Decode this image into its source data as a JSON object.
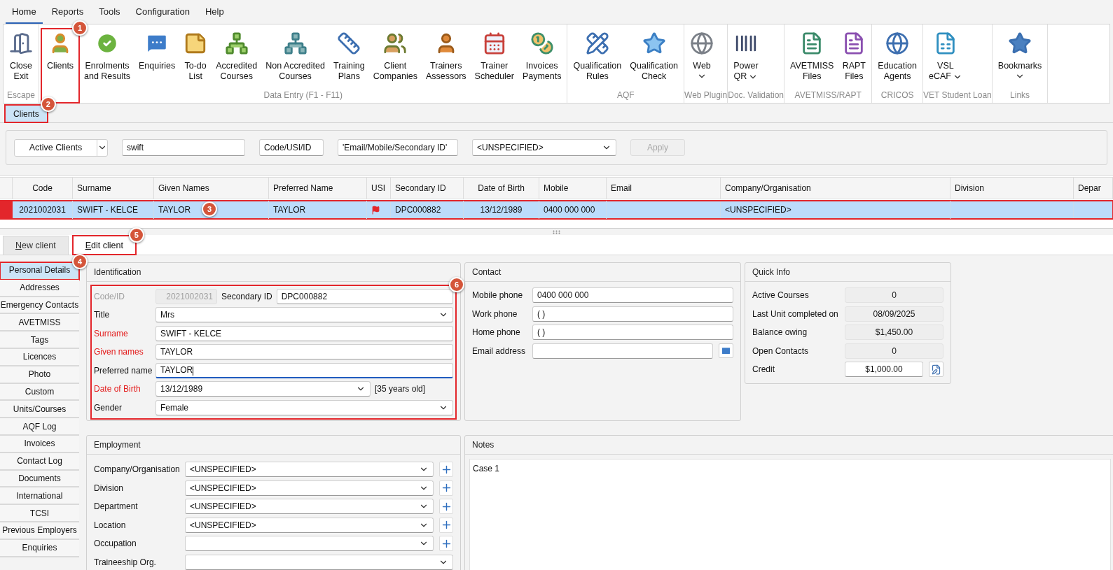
{
  "menu": [
    {
      "label": "Home",
      "selected": true
    },
    {
      "label": "Reports",
      "selected": false
    },
    {
      "label": "Tools",
      "selected": false
    },
    {
      "label": "Configuration",
      "selected": false
    },
    {
      "label": "Help",
      "selected": false
    }
  ],
  "ribbon": [
    {
      "label": "Escape",
      "buttons": [
        {
          "lines": [
            "Close",
            "Exit"
          ],
          "dropdown": false,
          "outlined": false
        }
      ]
    },
    {
      "label": "Data Entry (F1 - F11)",
      "buttons": [
        {
          "lines": [
            "Clients"
          ],
          "dropdown": false,
          "outlined": true,
          "callout": "1"
        },
        {
          "lines": [
            "Enrolments",
            "and Results"
          ],
          "dropdown": false,
          "outlined": false
        },
        {
          "lines": [
            "Enquiries"
          ],
          "dropdown": false,
          "outlined": false
        },
        {
          "lines": [
            "To-do",
            "List"
          ],
          "dropdown": false,
          "outlined": false
        },
        {
          "lines": [
            "Accredited",
            "Courses"
          ],
          "dropdown": false,
          "outlined": false
        },
        {
          "lines": [
            "Non Accredited",
            "Courses"
          ],
          "dropdown": false,
          "outlined": false
        },
        {
          "lines": [
            "Training",
            "Plans"
          ],
          "dropdown": false,
          "outlined": false
        },
        {
          "lines": [
            "Client",
            "Companies"
          ],
          "dropdown": false,
          "outlined": false
        },
        {
          "lines": [
            "Trainers",
            "Assessors"
          ],
          "dropdown": false,
          "outlined": false
        },
        {
          "lines": [
            "Trainer",
            "Scheduler"
          ],
          "dropdown": false,
          "outlined": false
        },
        {
          "lines": [
            "Invoices",
            "Payments"
          ],
          "dropdown": false,
          "outlined": false
        }
      ]
    },
    {
      "label": "AQF",
      "buttons": [
        {
          "lines": [
            "Qualification",
            "Rules"
          ],
          "dropdown": false,
          "outlined": false
        },
        {
          "lines": [
            "Qualification",
            "Check"
          ],
          "dropdown": false,
          "outlined": false
        }
      ]
    },
    {
      "label": "Web Plugin",
      "buttons": [
        {
          "lines": [
            "Web"
          ],
          "dropdown": true,
          "outlined": false
        }
      ]
    },
    {
      "label": "Doc. Validation",
      "buttons": [
        {
          "lines": [
            "Power",
            "QR"
          ],
          "dropdown": true,
          "outlined": false
        }
      ]
    },
    {
      "label": "AVETMISS/RAPT",
      "buttons": [
        {
          "lines": [
            "AVETMISS",
            "Files"
          ],
          "dropdown": false,
          "outlined": false
        },
        {
          "lines": [
            "RAPT",
            "Files"
          ],
          "dropdown": false,
          "outlined": false
        }
      ]
    },
    {
      "label": "CRICOS",
      "buttons": [
        {
          "lines": [
            "Education",
            "Agents"
          ],
          "dropdown": false,
          "outlined": false
        }
      ]
    },
    {
      "label": "VET Student Loan",
      "buttons": [
        {
          "lines": [
            "VSL",
            "eCAF"
          ],
          "dropdown": true,
          "outlined": false
        }
      ]
    },
    {
      "label": "Links",
      "buttons": [
        {
          "lines": [
            "Bookmarks"
          ],
          "dropdown": true,
          "outlined": false
        }
      ]
    }
  ],
  "document_tabs": [
    {
      "label": "Clients",
      "selected": true,
      "outlined": true,
      "callout": "2"
    }
  ],
  "filter": {
    "status": "Active Clients",
    "search": "swift",
    "code_field": "Code/USI/ID",
    "contact_field": "'Email/Mobile/Secondary ID'",
    "company": "<UNSPECIFIED>",
    "apply": {
      "label": "Apply",
      "disabled": true
    }
  },
  "table": {
    "columns": [
      "Code",
      "Surname",
      "Given Names",
      "Preferred Name",
      "USI",
      "Secondary ID",
      "Date of Birth",
      "Mobile",
      "Email",
      "Company/Organisation",
      "Division",
      "Depar"
    ],
    "rows": [
      {
        "selected": true,
        "outlined": true,
        "callout": "3",
        "cells": [
          {
            "kind": "text",
            "text": "2021002031"
          },
          {
            "kind": "text",
            "text": "SWIFT - KELCE"
          },
          {
            "kind": "text",
            "text": "TAYLOR"
          },
          {
            "kind": "text",
            "text": "TAYLOR"
          },
          {
            "kind": "flag"
          },
          {
            "kind": "text",
            "text": "DPC000882"
          },
          {
            "kind": "text",
            "text": "13/12/1989"
          },
          {
            "kind": "text",
            "text": "0400 000 000"
          },
          {
            "kind": "blank"
          },
          {
            "kind": "text",
            "text": "<UNSPECIFIED>"
          },
          {
            "kind": "blank"
          },
          {
            "kind": "blank"
          }
        ]
      }
    ]
  },
  "tabs": [
    {
      "label": "New client",
      "selected": false,
      "outlined": false
    },
    {
      "label": "Edit client",
      "selected": true,
      "outlined": true,
      "callout": "5"
    }
  ],
  "sidebar": {
    "items": [
      {
        "label": "Personal Details",
        "selected": true,
        "outlined": true,
        "callout": "4"
      },
      {
        "label": "Addresses",
        "selected": false,
        "outlined": false
      },
      {
        "label": "Emergency Contacts",
        "selected": false,
        "outlined": false
      },
      {
        "label": "AVETMISS",
        "selected": false,
        "outlined": false
      },
      {
        "label": "Tags",
        "selected": false,
        "outlined": false
      },
      {
        "label": "Licences",
        "selected": false,
        "outlined": false
      },
      {
        "label": "Photo",
        "selected": false,
        "outlined": false
      },
      {
        "label": "Custom",
        "selected": false,
        "outlined": false
      },
      {
        "label": "Units/Courses",
        "selected": false,
        "outlined": false
      },
      {
        "label": "AQF Log",
        "selected": false,
        "outlined": false
      },
      {
        "label": "Invoices",
        "selected": false,
        "outlined": false
      },
      {
        "label": "Contact Log",
        "selected": false,
        "outlined": false
      },
      {
        "label": "Documents",
        "selected": false,
        "outlined": false
      },
      {
        "label": "International",
        "selected": false,
        "outlined": false
      },
      {
        "label": "TCSI",
        "selected": false,
        "outlined": false
      },
      {
        "label": "Previous Employers",
        "selected": false,
        "outlined": false
      },
      {
        "label": "Enquiries",
        "selected": false,
        "outlined": false
      }
    ]
  },
  "identification": {
    "title": "Identification",
    "outlined": true,
    "callout": "6",
    "code": {
      "label": "Code/ID",
      "value": "2021002031",
      "disabled": true,
      "secondary_label": "Secondary ID",
      "secondary_value": "DPC000882"
    },
    "fields": [
      {
        "kind": "select",
        "label": "Title",
        "value": "Mrs",
        "required": false,
        "focused": false
      },
      {
        "kind": "text",
        "label": "Surname",
        "value": "SWIFT - KELCE",
        "required": true,
        "focused": false
      },
      {
        "kind": "text",
        "label": "Given names",
        "value": "TAYLOR",
        "required": true,
        "focused": false
      },
      {
        "kind": "text",
        "label": "Preferred name",
        "value": "TAYLOR",
        "required": false,
        "focused": true
      },
      {
        "kind": "select",
        "label": "Date of Birth",
        "value": "13/12/1989",
        "required": true,
        "focused": false,
        "note": "[35 years old]"
      },
      {
        "kind": "select",
        "label": "Gender",
        "value": "Female",
        "required": false,
        "focused": false
      }
    ]
  },
  "contact": {
    "title": "Contact",
    "fields": [
      {
        "label": "Mobile phone",
        "value": "0400 000 000",
        "mail": false
      },
      {
        "label": "Work phone",
        "value": "( )",
        "mail": false
      },
      {
        "label": "Home phone",
        "value": "( )",
        "mail": false
      },
      {
        "label": "Email address",
        "mail": true
      }
    ]
  },
  "quick_info": {
    "title": "Quick Info",
    "items": [
      {
        "label": "Active Courses",
        "value": "0",
        "editable": false
      },
      {
        "label": "Last Unit completed on",
        "value": "08/09/2025",
        "editable": false
      },
      {
        "label": "Balance owing",
        "value": "$1,450.00",
        "editable": false
      },
      {
        "label": "Open Contacts",
        "value": "0",
        "editable": false
      },
      {
        "label": "Credit",
        "value": "$1,000.00",
        "editable": true
      }
    ]
  },
  "employment": {
    "title": "Employment",
    "fields": [
      {
        "label": "Company/Organisation",
        "value": "<UNSPECIFIED>",
        "add": true
      },
      {
        "label": "Division",
        "value": "<UNSPECIFIED>",
        "add": true
      },
      {
        "label": "Department",
        "value": "<UNSPECIFIED>",
        "add": true
      },
      {
        "label": "Location",
        "value": "<UNSPECIFIED>",
        "add": true
      },
      {
        "label": "Occupation",
        "add": true
      },
      {
        "label": "Traineeship Org.",
        "add": false
      }
    ]
  },
  "notes": {
    "title": "Notes",
    "text": "Case 1"
  }
}
